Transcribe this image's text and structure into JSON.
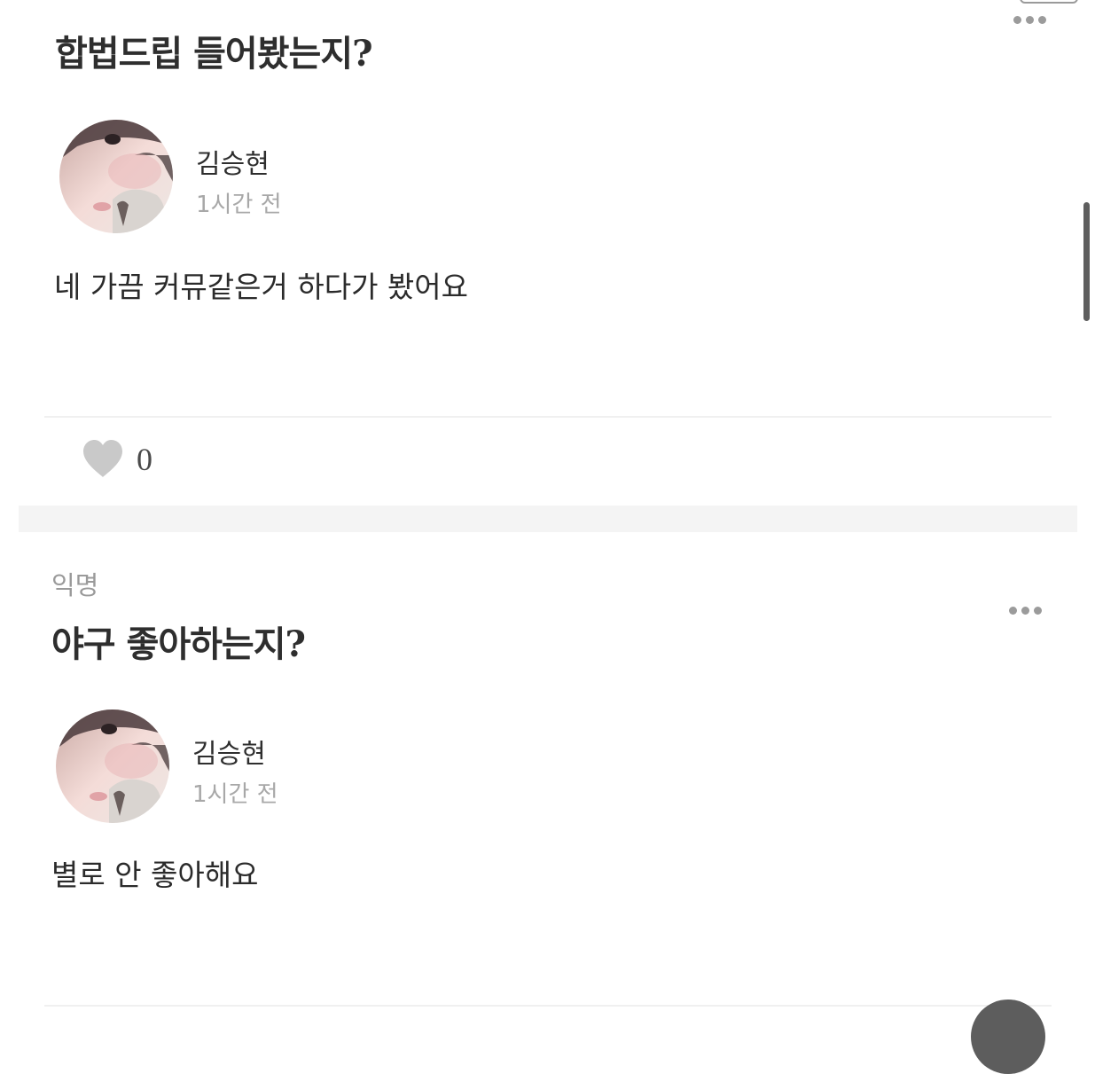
{
  "cards": [
    {
      "question": "합법드립 들어봤는지",
      "question_mark": "?",
      "author": "김승현",
      "time": "1시간 전",
      "answer": "네 가끔 커뮤같은거 하다가 봤어요",
      "likes": "0"
    },
    {
      "label": "익명",
      "question": "야구 좋아하는지",
      "question_mark": "?",
      "author": "김승현",
      "time": "1시간 전",
      "answer": "별로 안 좋아해요"
    }
  ],
  "icons": {
    "more": "more-horizontal-icon",
    "like": "heart-icon"
  },
  "colors": {
    "background": "#ffffff",
    "text_primary": "#2e2e2e",
    "text_secondary": "#a8a8a8",
    "heart": "#c9c9c9",
    "separator": "#f4f4f4"
  }
}
